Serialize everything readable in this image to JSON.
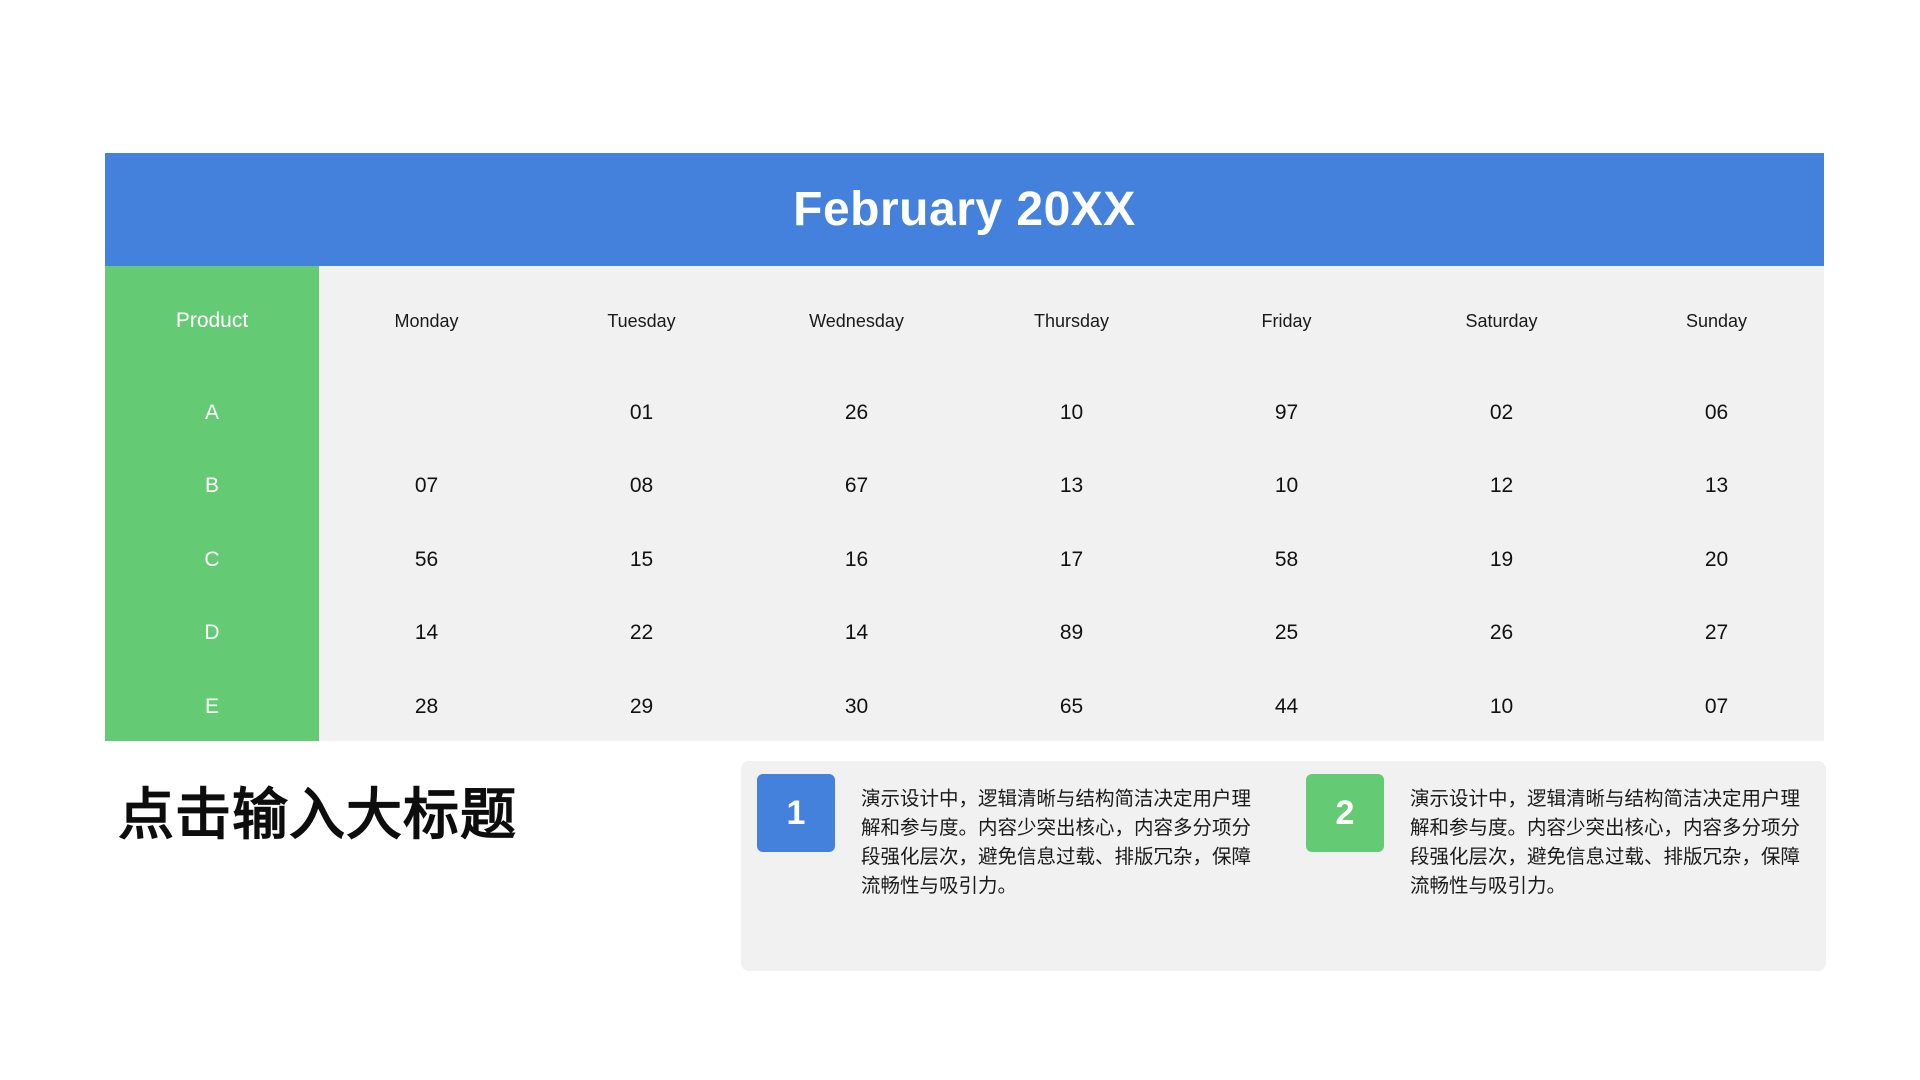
{
  "calendar": {
    "title": "February 20XX",
    "product_header": "Product",
    "days": [
      "Monday",
      "Tuesday",
      "Wednesday",
      "Thursday",
      "Friday",
      "Saturday",
      "Sunday"
    ],
    "rows": [
      {
        "product": "A",
        "values": [
          "",
          "01",
          "26",
          "10",
          "97",
          "02",
          "06"
        ]
      },
      {
        "product": "B",
        "values": [
          "07",
          "08",
          "67",
          "13",
          "10",
          "12",
          "13"
        ]
      },
      {
        "product": "C",
        "values": [
          "56",
          "15",
          "16",
          "17",
          "58",
          "19",
          "20"
        ]
      },
      {
        "product": "D",
        "values": [
          "14",
          "22",
          "14",
          "89",
          "25",
          "26",
          "27"
        ]
      },
      {
        "product": "E",
        "values": [
          "28",
          "29",
          "30",
          "65",
          "44",
          "10",
          "07"
        ]
      }
    ]
  },
  "heading": "点击输入大标题",
  "info_items": [
    {
      "number": "1",
      "text": "演示设计中，逻辑清晰与结构简洁决定用户理解和参与度。内容少突出核心，内容多分项分段强化层次，避免信息过载、排版冗杂，保障流畅性与吸引力。"
    },
    {
      "number": "2",
      "text": "演示设计中，逻辑清晰与结构简洁决定用户理解和参与度。内容少突出核心，内容多分项分段强化层次，避免信息过载、排版冗杂，保障流畅性与吸引力。"
    }
  ],
  "colors": {
    "blue": "#4481dd",
    "green": "#64cb74",
    "panel": "#f1f1f1"
  }
}
